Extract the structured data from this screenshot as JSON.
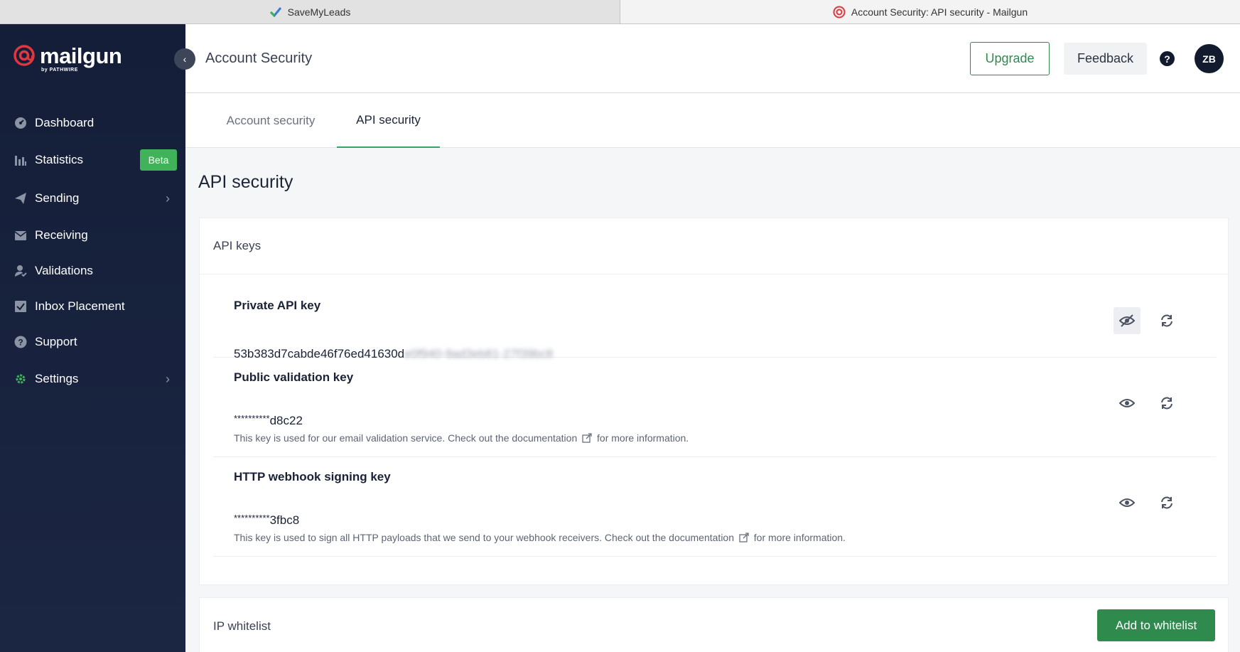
{
  "browser": {
    "tabs": [
      {
        "title": "SaveMyLeads",
        "favicon": "savemyleads-check-icon"
      },
      {
        "title": "Account Security: API security - Mailgun",
        "favicon": "mailgun-logo-icon"
      }
    ]
  },
  "sidebar": {
    "logo_text": "mailgun",
    "logo_sub": "by PATHWIRE",
    "items": [
      {
        "label": "Dashboard",
        "icon": "dashboard-icon"
      },
      {
        "label": "Statistics",
        "icon": "bar-chart-icon",
        "badge": "Beta"
      },
      {
        "label": "Sending",
        "icon": "paper-plane-icon",
        "has_submenu": true
      },
      {
        "label": "Receiving",
        "icon": "inbox-icon"
      },
      {
        "label": "Validations",
        "icon": "user-check-icon"
      },
      {
        "label": "Inbox Placement",
        "icon": "checkbox-icon"
      },
      {
        "label": "Support",
        "icon": "question-circle-icon"
      },
      {
        "label": "Settings",
        "icon": "gear-icon",
        "has_submenu": true
      }
    ]
  },
  "header": {
    "title": "Account Security",
    "upgrade_label": "Upgrade",
    "feedback_label": "Feedback",
    "help_glyph": "?",
    "avatar_initials": "ZB"
  },
  "tabs": [
    {
      "label": "Account security",
      "active": false
    },
    {
      "label": "API security",
      "active": true
    }
  ],
  "main": {
    "section_title": "API security",
    "api_keys": {
      "heading": "API keys",
      "keys": [
        {
          "title": "Private API key",
          "value_visible": "53b383d7cabde46f76ed41630d",
          "value_blurred": "e0f940-9ad3eb81-27f39bc8",
          "description": "",
          "visibility_icon": "eye-slash-icon"
        },
        {
          "title": "Public validation key",
          "value_mask": "**********",
          "value_visible": "d8c22",
          "description_pre": "This key is used for our email validation service. Check out the documentation",
          "description_post": "for more information.",
          "visibility_icon": "eye-icon"
        },
        {
          "title": "HTTP webhook signing key",
          "value_mask": "**********",
          "value_visible": "3fbc8",
          "description_pre": "This key is used to sign all HTTP payloads that we send to your webhook receivers. Check out the documentation",
          "description_post": "for more information.",
          "visibility_icon": "eye-icon"
        }
      ]
    },
    "ip_whitelist": {
      "heading": "IP whitelist",
      "add_label": "Add to whitelist"
    }
  },
  "colors": {
    "sidebar_bg": "#141e38",
    "accent_green": "#2f8a4e",
    "beta_green": "#3fb25a",
    "brand_red": "#e0373f"
  }
}
